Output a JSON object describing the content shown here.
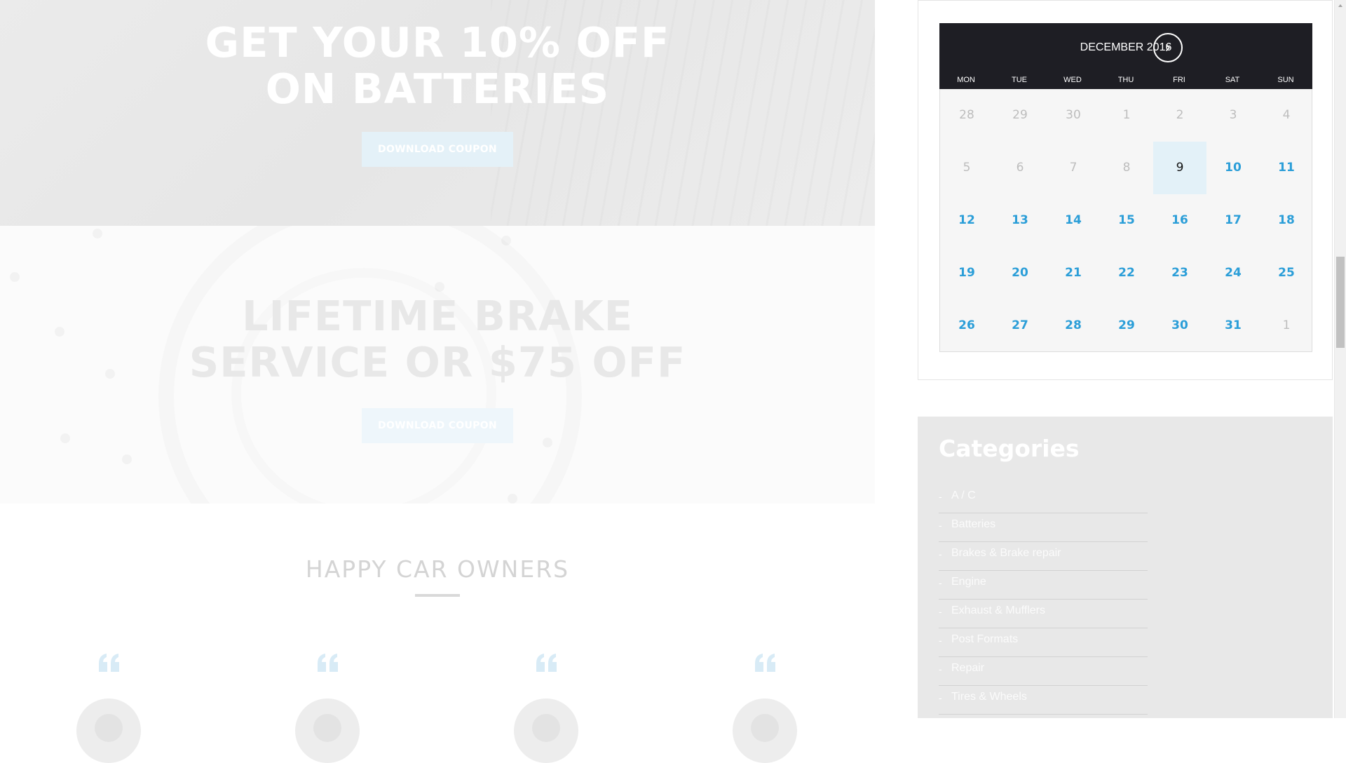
{
  "promo1": {
    "headline_line1": "GET YOUR 10% OFF",
    "headline_line2": "ON BATTERIES",
    "button": "DOWNLOAD COUPON"
  },
  "promo2": {
    "headline_line1": "LIFETIME BRAKE",
    "headline_line2": "SERVICE OR $75 OFF",
    "button": "DOWNLOAD COUPON"
  },
  "testimonials": {
    "title": "HAPPY CAR OWNERS"
  },
  "calendar": {
    "month": "DECEMBER 2016",
    "weekdays": [
      "MON",
      "TUE",
      "WED",
      "THU",
      "FRI",
      "SAT",
      "SUN"
    ],
    "weeks": [
      [
        "28",
        "29",
        "30",
        "1",
        "2",
        "3",
        "4"
      ],
      [
        "5",
        "6",
        "7",
        "8",
        "9",
        "10",
        "11"
      ],
      [
        "12",
        "13",
        "14",
        "15",
        "16",
        "17",
        "18"
      ],
      [
        "19",
        "20",
        "21",
        "22",
        "23",
        "24",
        "25"
      ],
      [
        "26",
        "27",
        "28",
        "29",
        "30",
        "31",
        "1"
      ]
    ],
    "today": "9",
    "colors": {
      "header_bg": "#1e1e24",
      "link": "#2b9ed8",
      "muted": "#bdbdbd",
      "today_bg": "#e3f1f8"
    }
  },
  "categories": {
    "title": "Categories",
    "items": [
      "A / C",
      "Batteries",
      "Brakes & Brake repair",
      "Engine",
      "Exhaust & Mufflers",
      "Post Formats",
      "Repair",
      "Tires & Wheels"
    ]
  },
  "icons": {
    "next_month": "chevron-right-icon",
    "quote": "quote-icon",
    "scroll_up": "arrow-up-icon"
  }
}
